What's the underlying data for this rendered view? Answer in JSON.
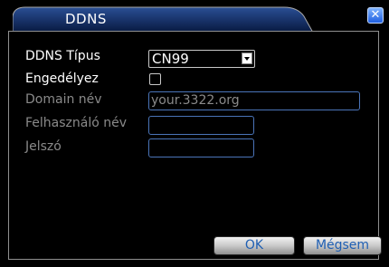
{
  "dialog": {
    "title": "DDNS",
    "close_symbol": "✕"
  },
  "form": {
    "ddns_type_label": "DDNS Típus",
    "ddns_type_value": "CN99",
    "enable_label": "Engedélyez",
    "domain_label": "Domain név",
    "domain_value": "your.3322.org",
    "username_label": "Felhasználó név",
    "username_value": "",
    "password_label": "Jelszó",
    "password_value": ""
  },
  "buttons": {
    "ok_label": "OK",
    "cancel_label": "Mégsem"
  },
  "colors": {
    "background": "#000000",
    "title_tab": "#0d2b66",
    "field_border": "#4a74b8",
    "close_button": "#1f5fe0",
    "button_text": "#1f5fb3"
  }
}
